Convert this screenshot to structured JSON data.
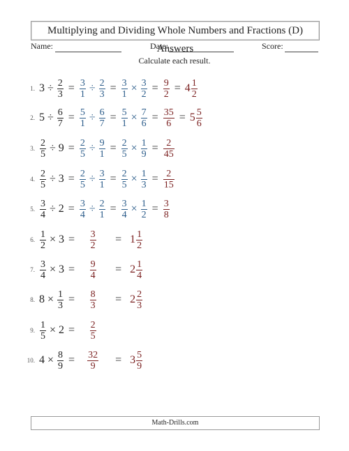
{
  "title": "Multiplying and Dividing Whole Numbers and Fractions (D) Answers",
  "fields": {
    "name_label": "Name:",
    "date_label": "Date:",
    "score_label": "Score:"
  },
  "instructions": "Calculate each result.",
  "colors": {
    "problem": "#222222",
    "step": "#2b5c8a",
    "answer": "#7a1f1f"
  },
  "problems": [
    {
      "number": "1.",
      "type": "divide",
      "expr": [
        [
          "3"
        ],
        "÷",
        [
          "2",
          "3"
        ]
      ],
      "step1": [
        [
          "3",
          "1"
        ],
        "÷",
        [
          "2",
          "3"
        ]
      ],
      "step2": [
        [
          "3",
          "1"
        ],
        "×",
        [
          "3",
          "2"
        ]
      ],
      "improper": [
        "9",
        "2"
      ],
      "mixed": [
        "4",
        "1",
        "2"
      ]
    },
    {
      "number": "2.",
      "type": "divide",
      "expr": [
        [
          "5"
        ],
        "÷",
        [
          "6",
          "7"
        ]
      ],
      "step1": [
        [
          "5",
          "1"
        ],
        "÷",
        [
          "6",
          "7"
        ]
      ],
      "step2": [
        [
          "5",
          "1"
        ],
        "×",
        [
          "7",
          "6"
        ]
      ],
      "improper": [
        "35",
        "6"
      ],
      "mixed": [
        "5",
        "5",
        "6"
      ]
    },
    {
      "number": "3.",
      "type": "divide",
      "expr": [
        [
          "2",
          "5"
        ],
        "÷",
        [
          "9"
        ]
      ],
      "step1": [
        [
          "2",
          "5"
        ],
        "÷",
        [
          "9",
          "1"
        ]
      ],
      "step2": [
        [
          "2",
          "5"
        ],
        "×",
        [
          "1",
          "9"
        ]
      ],
      "improper": [
        "2",
        "45"
      ],
      "mixed": null
    },
    {
      "number": "4.",
      "type": "divide",
      "expr": [
        [
          "2",
          "5"
        ],
        "÷",
        [
          "3"
        ]
      ],
      "step1": [
        [
          "2",
          "5"
        ],
        "÷",
        [
          "3",
          "1"
        ]
      ],
      "step2": [
        [
          "2",
          "5"
        ],
        "×",
        [
          "1",
          "3"
        ]
      ],
      "improper": [
        "2",
        "15"
      ],
      "mixed": null
    },
    {
      "number": "5.",
      "type": "divide",
      "expr": [
        [
          "3",
          "4"
        ],
        "÷",
        [
          "2"
        ]
      ],
      "step1": [
        [
          "3",
          "4"
        ],
        "÷",
        [
          "2",
          "1"
        ]
      ],
      "step2": [
        [
          "3",
          "4"
        ],
        "×",
        [
          "1",
          "2"
        ]
      ],
      "improper": [
        "3",
        "8"
      ],
      "mixed": null
    },
    {
      "number": "6.",
      "type": "multiply",
      "expr": [
        [
          "1",
          "2"
        ],
        "×",
        [
          "3"
        ]
      ],
      "improper": [
        "3",
        "2"
      ],
      "mixed": [
        "1",
        "1",
        "2"
      ]
    },
    {
      "number": "7.",
      "type": "multiply",
      "expr": [
        [
          "3",
          "4"
        ],
        "×",
        [
          "3"
        ]
      ],
      "improper": [
        "9",
        "4"
      ],
      "mixed": [
        "2",
        "1",
        "4"
      ]
    },
    {
      "number": "8.",
      "type": "multiply",
      "expr": [
        [
          "8"
        ],
        "×",
        [
          "1",
          "3"
        ]
      ],
      "improper": [
        "8",
        "3"
      ],
      "mixed": [
        "2",
        "2",
        "3"
      ]
    },
    {
      "number": "9.",
      "type": "multiply",
      "expr": [
        [
          "1",
          "5"
        ],
        "×",
        [
          "2"
        ]
      ],
      "improper": [
        "2",
        "5"
      ],
      "mixed": null
    },
    {
      "number": "10.",
      "type": "multiply",
      "expr": [
        [
          "4"
        ],
        "×",
        [
          "8",
          "9"
        ]
      ],
      "improper": [
        "32",
        "9"
      ],
      "mixed": [
        "3",
        "5",
        "9"
      ]
    }
  ],
  "symbols": {
    "equals": "="
  },
  "footer": "Math-Drills.com"
}
